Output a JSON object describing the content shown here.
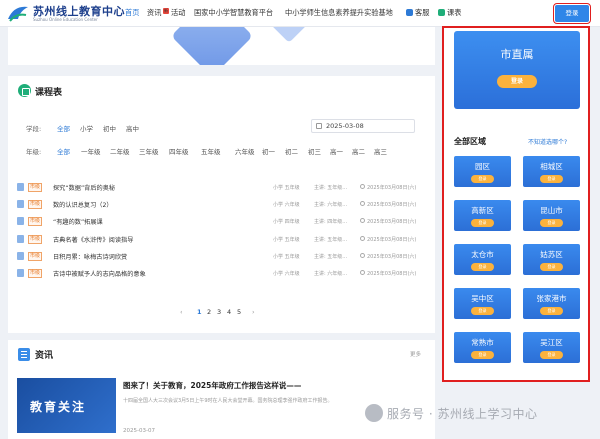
{
  "header": {
    "logo_title": "苏州线上教育中心",
    "logo_sub": "Suzhou Online Education Center",
    "nav": [
      {
        "label": "首页",
        "active": true
      },
      {
        "label": "资讯",
        "active": false
      },
      {
        "label": "活动",
        "active": false
      },
      {
        "label": "国家中小学智慧教育平台",
        "active": false
      },
      {
        "label": "中小学师生信息素养提升实验基地",
        "active": false
      },
      {
        "label": "客服",
        "active": false
      },
      {
        "label": "课表",
        "active": false
      }
    ],
    "login": "登录"
  },
  "course": {
    "title": "课程表",
    "stage_label": "学段:",
    "stages": [
      "全部",
      "小学",
      "初中",
      "高中"
    ],
    "grade_label": "年级:",
    "grades": [
      "全部",
      "一年级",
      "二年级",
      "三年级",
      "四年级",
      "五年级",
      "六年级",
      "初一",
      "初二",
      "初三",
      "高一",
      "高二",
      "高三"
    ],
    "date": "2025-03-08",
    "rows": [
      {
        "tag": "市级",
        "title": "探究“数据”背后的奥秘",
        "grade": "小学 五年级",
        "speaker": "主讲: 五年级...",
        "date": "2025年03月08日(六)"
      },
      {
        "tag": "市级",
        "title": "数的认识总复习（2）",
        "grade": "小学 六年级",
        "speaker": "主讲: 六年级...",
        "date": "2025年03月08日(六)"
      },
      {
        "tag": "市级",
        "title": "“有趣的数”拓展课",
        "grade": "小学 四年级",
        "speaker": "主讲: 四年级...",
        "date": "2025年03月08日(六)"
      },
      {
        "tag": "市级",
        "title": "古典名著《水浒传》阅读指导",
        "grade": "小学 五年级",
        "speaker": "主讲: 五年级...",
        "date": "2025年03月08日(六)"
      },
      {
        "tag": "市级",
        "title": "日积月累：咏梅古诗词欣赏",
        "grade": "小学 五年级",
        "speaker": "主讲: 五年级...",
        "date": "2025年03月08日(六)"
      },
      {
        "tag": "市级",
        "title": "古诗中被赋予人的志向品格的意象",
        "grade": "小学 六年级",
        "speaker": "主讲: 六年级...",
        "date": "2025年03月08日(六)"
      }
    ],
    "pager": {
      "prev": "‹",
      "pages": [
        "1",
        "2",
        "3",
        "4",
        "5"
      ],
      "next": "›"
    }
  },
  "news": {
    "title": "资讯",
    "more": "更多",
    "thumb_text": "教育关注",
    "article_title": "图来了！关于教育，2025年政府工作报告这样说——",
    "article_summary": "十四届全国人大三次会议3月5日上午9时在人民大会堂开幕。国务院总理李强作政府工作报告。",
    "article_date": "2025-03-07"
  },
  "right": {
    "city_title": "市直属",
    "city_login": "登录",
    "region_head": "全部区域",
    "region_hint": "不知道选哪个?",
    "districts": [
      {
        "name": "园区",
        "login": "登录"
      },
      {
        "name": "相城区",
        "login": "登录"
      },
      {
        "name": "高新区",
        "login": "登录"
      },
      {
        "name": "昆山市",
        "login": "登录"
      },
      {
        "name": "太仓市",
        "login": "登录"
      },
      {
        "name": "姑苏区",
        "login": "登录"
      },
      {
        "name": "吴中区",
        "login": "登录"
      },
      {
        "name": "张家港市",
        "login": "登录"
      },
      {
        "name": "常熟市",
        "login": "登录"
      },
      {
        "name": "吴江区",
        "login": "登录"
      }
    ]
  },
  "watermark": {
    "text": "服务号 · 苏州线上学习中心"
  },
  "colors": {
    "primary": "#2f86e8",
    "accent": "#fbb23d",
    "highlight_border": "#e01f1f",
    "tag": "#e77d2c"
  }
}
